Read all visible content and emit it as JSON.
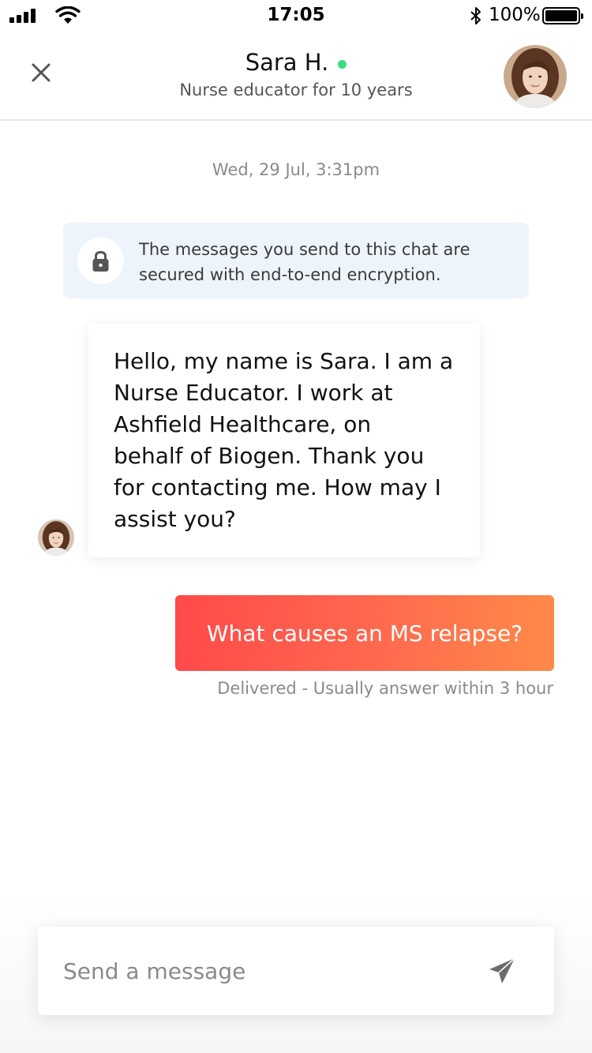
{
  "status_bar": {
    "time": "17:05",
    "battery_percent": "100%",
    "icons": [
      "signal-icon",
      "wifi-icon",
      "bluetooth-icon",
      "battery-icon"
    ]
  },
  "header": {
    "name": "Sara H.",
    "subtitle": "Nurse educator for 10 years",
    "online": true,
    "online_color": "#3ddc84",
    "close_icon": "close-icon"
  },
  "conversation": {
    "timestamp": "Wed, 29 Jul, 3:31pm",
    "encryption_notice": {
      "line1": "The messages you send to this chat are",
      "line2": "secured with end-to-end encryption.",
      "icon": "lock-icon"
    },
    "incoming": {
      "lines": [
        "Hello, my name is Sara. I am a",
        "Nurse Educator. I work at",
        "Ashfield Healthcare, on",
        "behalf of Biogen. Thank you",
        "for contacting me. How may I",
        "assist you?"
      ]
    },
    "outgoing": {
      "text": "What causes an MS relapse?",
      "gradient_colors": [
        "#ff4a4a",
        "#ff8a48"
      ],
      "status": "Delivered - Usually answer within 3 hour"
    }
  },
  "composer": {
    "placeholder": "Send a message",
    "value": "",
    "send_icon": "send-icon"
  }
}
